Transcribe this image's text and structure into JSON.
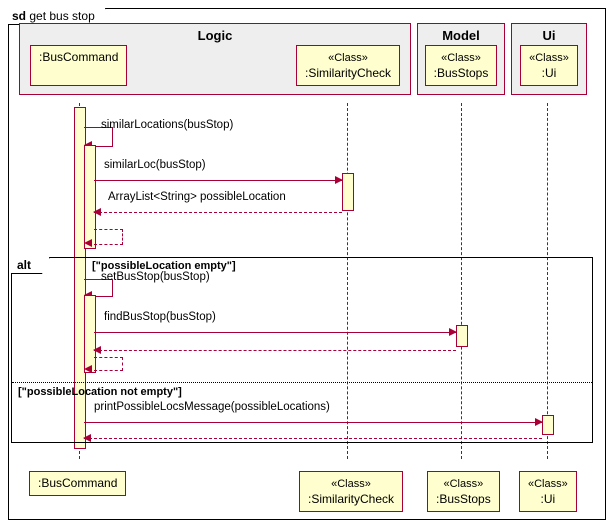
{
  "frame": {
    "keyword": "sd",
    "name": "get bus stop"
  },
  "headers": {
    "logic": "Logic",
    "model": "Model",
    "ui": "Ui"
  },
  "participants": {
    "bus_command": ":BusCommand",
    "similarity": {
      "stereo": "«Class»",
      "name": ":SimilarityCheck"
    },
    "bus_stops": {
      "stereo": "«Class»",
      "name": ":BusStops"
    },
    "ui": {
      "stereo": "«Class»",
      "name": ":Ui"
    }
  },
  "messages": {
    "m1": "similarLocations(busStop)",
    "m2": "similarLoc(busStop)",
    "r2": "ArrayList<String> possibleLocation",
    "m3": "setBusStop(busStop)",
    "m4": "findBusStop(busStop)",
    "m5": "printPossibleLocsMessage(possibleLocations)"
  },
  "alt": {
    "label": "alt",
    "guard1": "[\"possibleLocation empty\"]",
    "guard2": "[\"possibleLocation not empty\"]"
  },
  "chart_data": {
    "type": "sequence_diagram",
    "frame": "sd get bus stop",
    "groups": [
      {
        "name": "Logic",
        "participants": [
          ":BusCommand",
          ":SimilarityCheck"
        ]
      },
      {
        "name": "Model",
        "participants": [
          ":BusStops"
        ]
      },
      {
        "name": "Ui",
        "participants": [
          ":Ui"
        ]
      }
    ],
    "participants": [
      {
        "id": "BusCommand",
        "label": ":BusCommand",
        "stereotype": null
      },
      {
        "id": "SimilarityCheck",
        "label": ":SimilarityCheck",
        "stereotype": "«Class»"
      },
      {
        "id": "BusStops",
        "label": ":BusStops",
        "stereotype": "«Class»"
      },
      {
        "id": "Ui",
        "label": ":Ui",
        "stereotype": "«Class»"
      }
    ],
    "interactions": [
      {
        "from": "BusCommand",
        "to": "BusCommand",
        "label": "similarLocations(busStop)",
        "kind": "self-call"
      },
      {
        "from": "BusCommand",
        "to": "SimilarityCheck",
        "label": "similarLoc(busStop)",
        "kind": "call"
      },
      {
        "from": "SimilarityCheck",
        "to": "BusCommand",
        "label": "ArrayList<String> possibleLocation",
        "kind": "return"
      },
      {
        "kind": "self-return",
        "from": "BusCommand",
        "to": "BusCommand"
      },
      {
        "kind": "alt",
        "branches": [
          {
            "guard": "[\"possibleLocation empty\"]",
            "steps": [
              {
                "from": "BusCommand",
                "to": "BusCommand",
                "label": "setBusStop(busStop)",
                "kind": "self-call"
              },
              {
                "from": "BusCommand",
                "to": "BusStops",
                "label": "findBusStop(busStop)",
                "kind": "call"
              },
              {
                "from": "BusStops",
                "to": "BusCommand",
                "kind": "return"
              },
              {
                "kind": "self-return",
                "from": "BusCommand",
                "to": "BusCommand"
              }
            ]
          },
          {
            "guard": "[\"possibleLocation not empty\"]",
            "steps": [
              {
                "from": "BusCommand",
                "to": "Ui",
                "label": "printPossibleLocsMessage(possibleLocations)",
                "kind": "call"
              },
              {
                "from": "Ui",
                "to": "BusCommand",
                "kind": "return"
              }
            ]
          }
        ]
      }
    ]
  }
}
